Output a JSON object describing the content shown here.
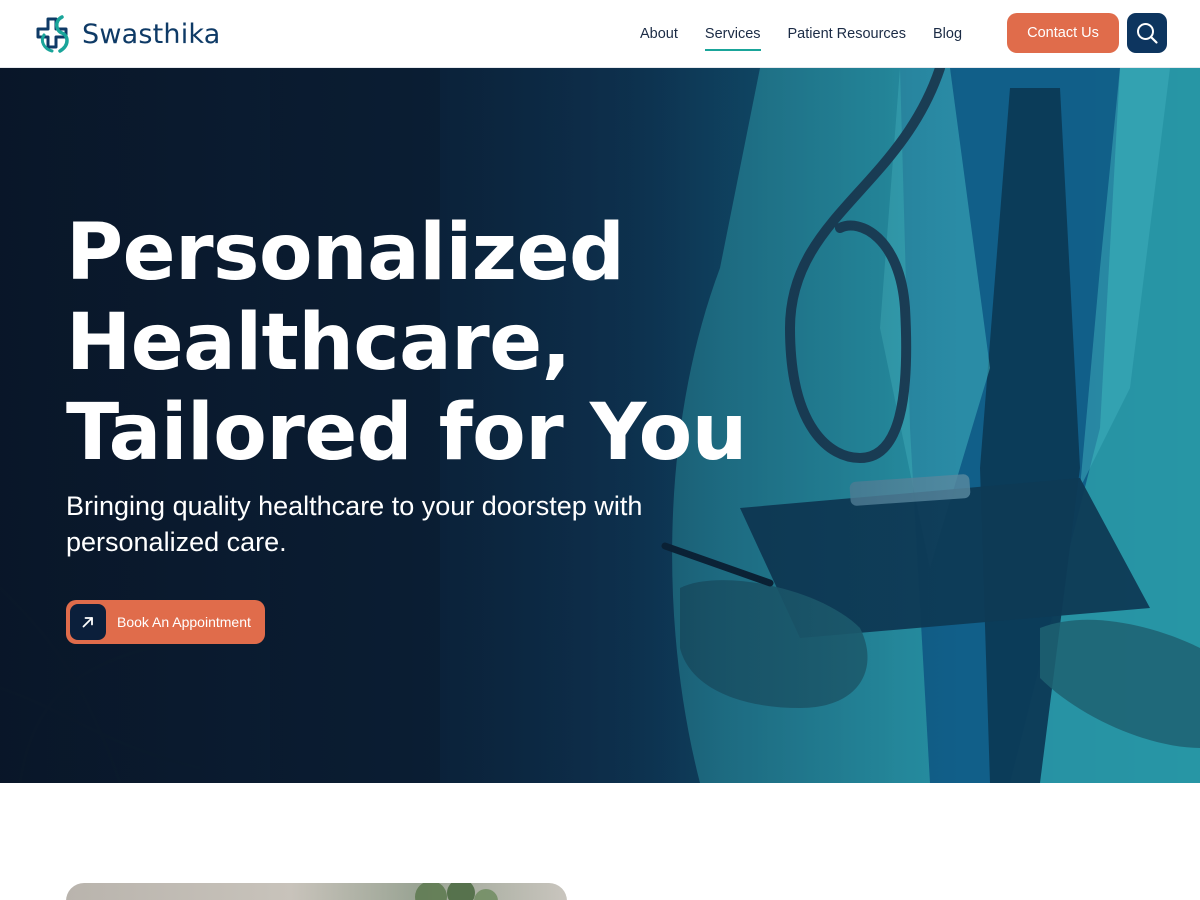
{
  "brand": {
    "name": "Swasthika",
    "logo_icon": "swasthika-cross-logo",
    "colors": {
      "primary": "#0d355f",
      "accent": "#e06c4b",
      "teal": "#1aa59a"
    }
  },
  "nav": {
    "items": [
      {
        "label": "About",
        "active": false
      },
      {
        "label": "Services",
        "active": true
      },
      {
        "label": "Patient Resources",
        "active": false
      },
      {
        "label": "Blog",
        "active": false
      }
    ]
  },
  "header": {
    "contact_label": "Contact Us",
    "search_icon": "search-icon"
  },
  "hero": {
    "title_lines": [
      "Personalized",
      "Healthcare,",
      "Tailored for You"
    ],
    "subtitle": "Bringing quality healthcare to your doorstep with personalized care.",
    "cta_label": "Book An Appointment",
    "cta_icon": "arrow-up-right-icon"
  }
}
